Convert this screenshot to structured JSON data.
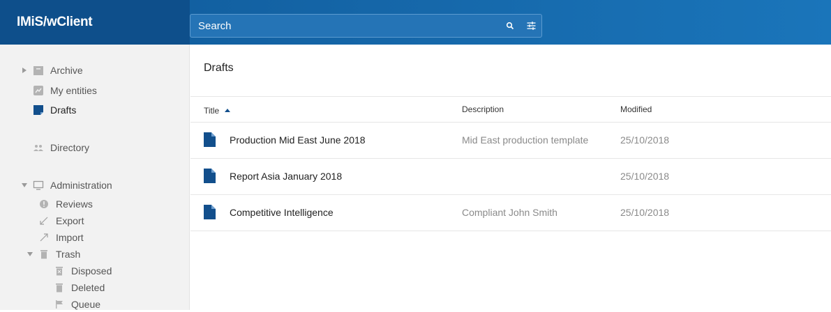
{
  "app": {
    "title": "IMiS/wClient"
  },
  "search": {
    "placeholder": "Search",
    "search_icon": "search-icon",
    "filter_icon": "filter-settings-icon"
  },
  "sidebar": {
    "items": [
      {
        "label": "Archive",
        "icon": "archive-icon"
      },
      {
        "label": "My entities",
        "icon": "my-entities-icon"
      },
      {
        "label": "Drafts",
        "icon": "drafts-icon"
      },
      {
        "label": "Directory",
        "icon": "directory-icon"
      },
      {
        "label": "Administration",
        "icon": "administration-icon"
      },
      {
        "label": "Reviews",
        "icon": "reviews-icon"
      },
      {
        "label": "Export",
        "icon": "export-icon"
      },
      {
        "label": "Import",
        "icon": "import-icon"
      },
      {
        "label": "Trash",
        "icon": "trash-icon"
      },
      {
        "label": "Disposed",
        "icon": "disposed-icon"
      },
      {
        "label": "Deleted",
        "icon": "deleted-icon"
      },
      {
        "label": "Queue",
        "icon": "queue-icon"
      }
    ]
  },
  "main": {
    "title": "Drafts",
    "columns": [
      "Title",
      "Description",
      "Modified"
    ],
    "rows": [
      {
        "title": "Production Mid East June 2018",
        "description": "Mid East production template",
        "modified": "25/10/2018"
      },
      {
        "title": "Report Asia January 2018",
        "description": "",
        "modified": "25/10/2018"
      },
      {
        "title": "Competitive Intelligence",
        "description": "Compliant John Smith",
        "modified": "25/10/2018"
      }
    ]
  },
  "colors": {
    "header_brand": "#0e4f8b",
    "header": "#1566a8",
    "accent": "#124f8c",
    "sidebar_bg": "#f2f2f2",
    "muted_text": "#8a8a8a"
  }
}
